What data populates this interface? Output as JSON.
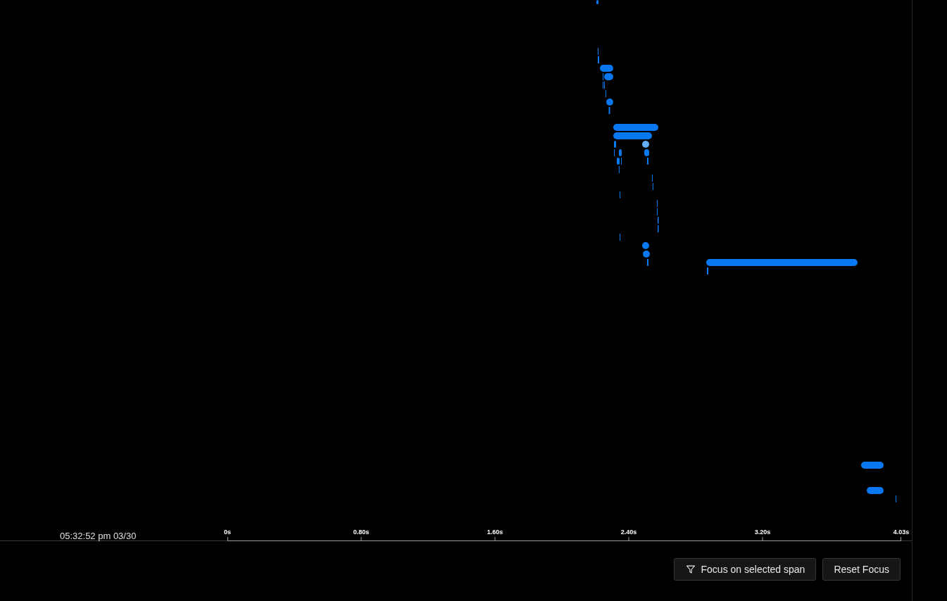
{
  "timeline": {
    "spans": [
      {
        "selected": false
      },
      {
        "selected": false
      },
      {
        "selected": false
      },
      {
        "selected": false
      },
      {
        "selected": false
      },
      {
        "selected": false
      },
      {
        "selected": false
      },
      {
        "selected": false
      },
      {
        "selected": false
      },
      {
        "selected": false
      },
      {
        "selected": false
      },
      {
        "selected": false
      },
      {
        "selected": false
      },
      {
        "selected": false
      },
      {
        "selected": true
      },
      {
        "selected": false
      },
      {
        "selected": false
      },
      {
        "selected": false
      },
      {
        "selected": false
      },
      {
        "selected": false
      },
      {
        "selected": false
      },
      {
        "selected": false
      },
      {
        "selected": false
      },
      {
        "selected": false
      },
      {
        "selected": false
      },
      {
        "selected": false
      },
      {
        "selected": false
      },
      {
        "selected": false
      },
      {
        "selected": false
      },
      {
        "selected": false
      },
      {
        "selected": false
      },
      {
        "selected": false
      },
      {
        "selected": false
      },
      {
        "selected": false
      },
      {
        "selected": false
      },
      {
        "selected": false
      },
      {
        "selected": false
      },
      {
        "selected": false
      }
    ]
  },
  "time_axis": {
    "start_time": "05:32:52 pm 03/30",
    "ticks": [
      "0s",
      "0.80s",
      "1.60s",
      "2.40s",
      "3.20s",
      "4.03s"
    ]
  },
  "focus_button": {
    "label": "Focus on selected span"
  },
  "reset_button": {
    "label": "Reset Focus"
  }
}
